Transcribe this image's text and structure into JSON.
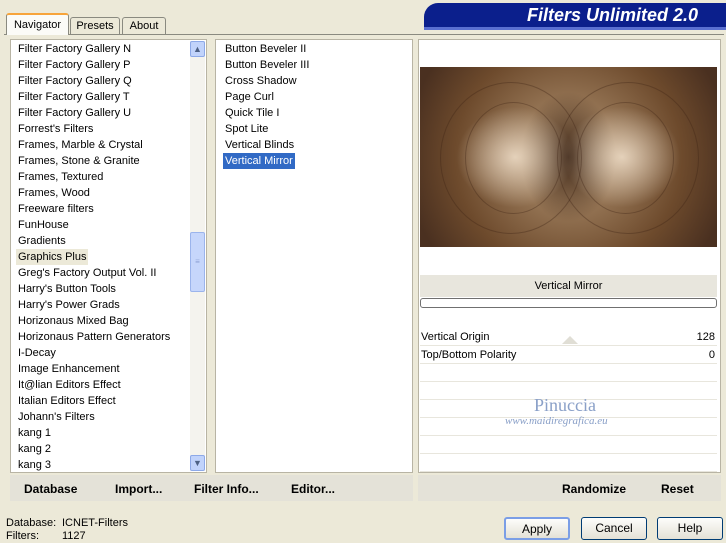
{
  "tabs": [
    "Navigator",
    "Presets",
    "About"
  ],
  "banner_title": "Filters Unlimited 2.0",
  "categories": [
    "Filter Factory Gallery N",
    "Filter Factory Gallery P",
    "Filter Factory Gallery Q",
    "Filter Factory Gallery T",
    "Filter Factory Gallery U",
    "Forrest's Filters",
    "Frames, Marble & Crystal",
    "Frames, Stone & Granite",
    "Frames, Textured",
    "Frames, Wood",
    "Freeware filters",
    "FunHouse",
    "Gradients",
    "Graphics Plus",
    "Greg's Factory Output Vol. II",
    "Harry's Button Tools",
    "Harry's Power Grads",
    "Horizonaus Mixed Bag",
    "Horizonaus Pattern Generators",
    "I-Decay",
    "Image Enhancement",
    "It@lian Editors Effect",
    "Italian Editors Effect",
    "Johann's Filters",
    "kang 1",
    "kang 2",
    "kang 3"
  ],
  "selected_category": "Graphics Plus",
  "filters": [
    "Button Beveler II",
    "Button Beveler III",
    "Cross Shadow",
    "Page Curl",
    "Quick Tile I",
    "Spot Lite",
    "Vertical Blinds",
    "Vertical Mirror"
  ],
  "selected_filter": "Vertical Mirror",
  "filter_name_display": "Vertical Mirror",
  "progress": 0,
  "params": [
    {
      "name": "Vertical Origin",
      "value": "128"
    },
    {
      "name": "Top/Bottom Polarity",
      "value": "0"
    }
  ],
  "watermark": {
    "line1": "Pinuccia",
    "line2": "www.maidiregrafica.eu"
  },
  "bottom_links": {
    "database": "Database",
    "import": "Import...",
    "filter_info": "Filter Info...",
    "editor": "Editor...",
    "randomize": "Randomize",
    "reset": "Reset"
  },
  "status": {
    "database_label": "Database:",
    "database_value": "ICNET-Filters",
    "filters_label": "Filters:",
    "filters_value": "1127"
  },
  "buttons": {
    "apply": "Apply",
    "cancel": "Cancel",
    "help": "Help"
  },
  "scroll_arrows": {
    "up": "▲",
    "down": "▼",
    "grip": "≡"
  }
}
